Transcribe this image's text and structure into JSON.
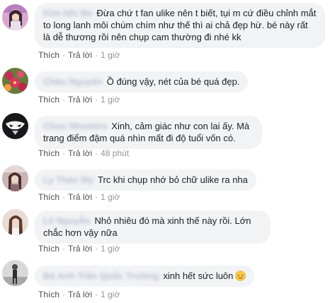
{
  "comments": [
    {
      "author": "Kim Nhi Be",
      "text": "Đừa chứ t fan ulike nên t biết, tụi m cứ điều chỉnh mắt to long lanh môi chúm chím như thế thì ai chả đẹp hừ. bé này rất là dễ thương rồi nên chụp cam thường đi nhé kk",
      "like_label": "Thích",
      "reply_label": "Trả lời",
      "separator": "·",
      "time": "1 giờ",
      "avatar_icon": "girl-portrait-icon"
    },
    {
      "author": "Châu Nguyên",
      "text": "Ồ đúng vậy, nét của bé quá đẹp.",
      "like_label": "Thích",
      "reply_label": "Trả lời",
      "separator": "·",
      "time": "1 giờ",
      "avatar_icon": "flowers-icon"
    },
    {
      "author": "Chan Nhumtro",
      "text": "Xinh, cảm giác như con lai ấy. Mà trang điểm đậm quá nhìn mất đi độ tuổi vốn có.",
      "like_label": "Thích",
      "reply_label": "Trả lời",
      "separator": "·",
      "time": "48 phút",
      "avatar_icon": "team-secret-logo-icon"
    },
    {
      "author": "Ly Thảo My",
      "text": "Trc khi chụp nhớ bỏ chữ ulike ra nha",
      "like_label": "Thích",
      "reply_label": "Trả lời",
      "separator": "·",
      "time": "1 giờ",
      "avatar_icon": "girl-photo-icon"
    },
    {
      "author": "Lê Nguyễn",
      "text": "Nhỏ nhiêu đó mà xinh thế này rồi. Lớn chắc hơn vậy nữa",
      "like_label": "Thích",
      "reply_label": "Trả lời",
      "separator": "·",
      "time": "1 giờ",
      "avatar_icon": "girl-selfie-icon"
    },
    {
      "author": "Bá Anh Trần Quốc Trường",
      "text": "xinh hết sức luôn",
      "emoji": "relieved-face-emoji-icon",
      "like_label": "Thích",
      "reply_label": "Trả lời",
      "separator": "·",
      "time": "1 giờ",
      "avatar_icon": "person-standing-icon"
    }
  ],
  "colors": {
    "bubble_bg": "#f2f3f5",
    "text": "#1c1e21",
    "action_text": "#4b4f56",
    "meta_text": "#90949c",
    "emoji_yellow": "#f7c948"
  }
}
